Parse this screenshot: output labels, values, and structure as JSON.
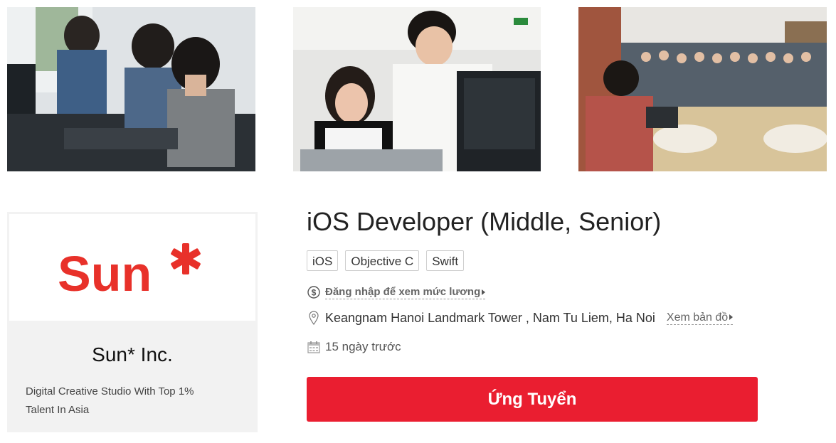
{
  "photos": [
    {
      "alt": "developers-working-photo"
    },
    {
      "alt": "colleagues-at-monitor-photo"
    },
    {
      "alt": "team-meeting-photo"
    }
  ],
  "company": {
    "logo_text": "Sun*",
    "brand_color": "#e8312a",
    "name": "Sun* Inc.",
    "slogan": "Digital Creative Studio With Top 1% Talent In Asia"
  },
  "job": {
    "title": "iOS Developer (Middle, Senior)",
    "skills": [
      "iOS",
      "Objective C",
      "Swift"
    ],
    "salary_link": "Đăng nhập để xem mức lương",
    "location": "Keangnam Hanoi Landmark Tower , Nam Tu Liem, Ha Noi",
    "map_link": "Xem bản đồ",
    "posted": "15 ngày trước",
    "apply_label": "Ứng Tuyển"
  },
  "icons": {
    "salary": "dollar-circle-icon",
    "location": "map-pin-icon",
    "date": "calendar-icon"
  },
  "colors": {
    "accent": "#ea1e30"
  }
}
